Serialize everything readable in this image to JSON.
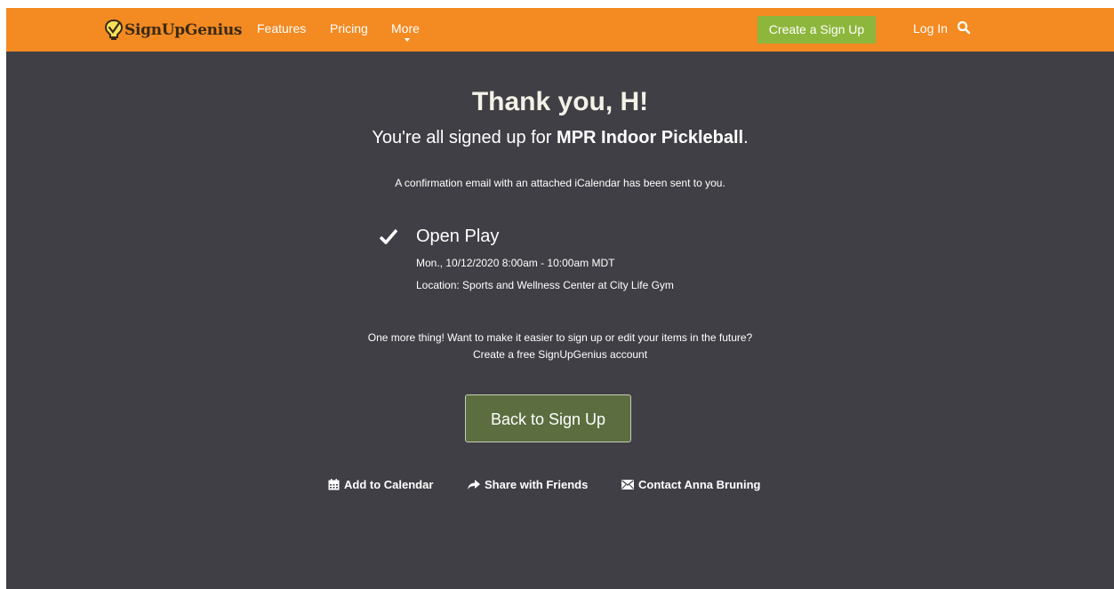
{
  "nav": {
    "logo_text": "SignUpGenius",
    "features": "Features",
    "pricing": "Pricing",
    "more": "More",
    "create": "Create a Sign Up",
    "login": "Log In"
  },
  "main": {
    "thanks": "Thank you, H!",
    "signed_up_prefix": "You're all signed up for ",
    "signup_name": "MPR Indoor Pickleball",
    "signed_up_suffix": ".",
    "confirmation": "A confirmation email with an attached iCalendar has been sent to you.",
    "item": {
      "title": "Open Play",
      "datetime": "Mon., 10/12/2020 8:00am - 10:00am MDT",
      "location": "Location: Sports and Wellness Center at City Life Gym"
    },
    "more_thing_line1": "One more thing! Want to make it easier to sign up or edit your items in the future?",
    "more_thing_line2": "Create a free SignUpGenius account",
    "back_button": "Back to Sign Up",
    "actions": {
      "calendar": "Add to Calendar",
      "share": "Share with Friends",
      "contact": "Contact Anna Bruning"
    }
  },
  "colors": {
    "nav_bg": "#f38a22",
    "page_bg": "#403f45",
    "create_btn": "#8db63c",
    "back_btn": "#5c6e40"
  },
  "icons": [
    "lightbulb-logo-icon",
    "chevron-down-icon",
    "search-icon",
    "checkmark-icon",
    "calendar-icon",
    "share-arrow-icon",
    "envelope-icon"
  ]
}
